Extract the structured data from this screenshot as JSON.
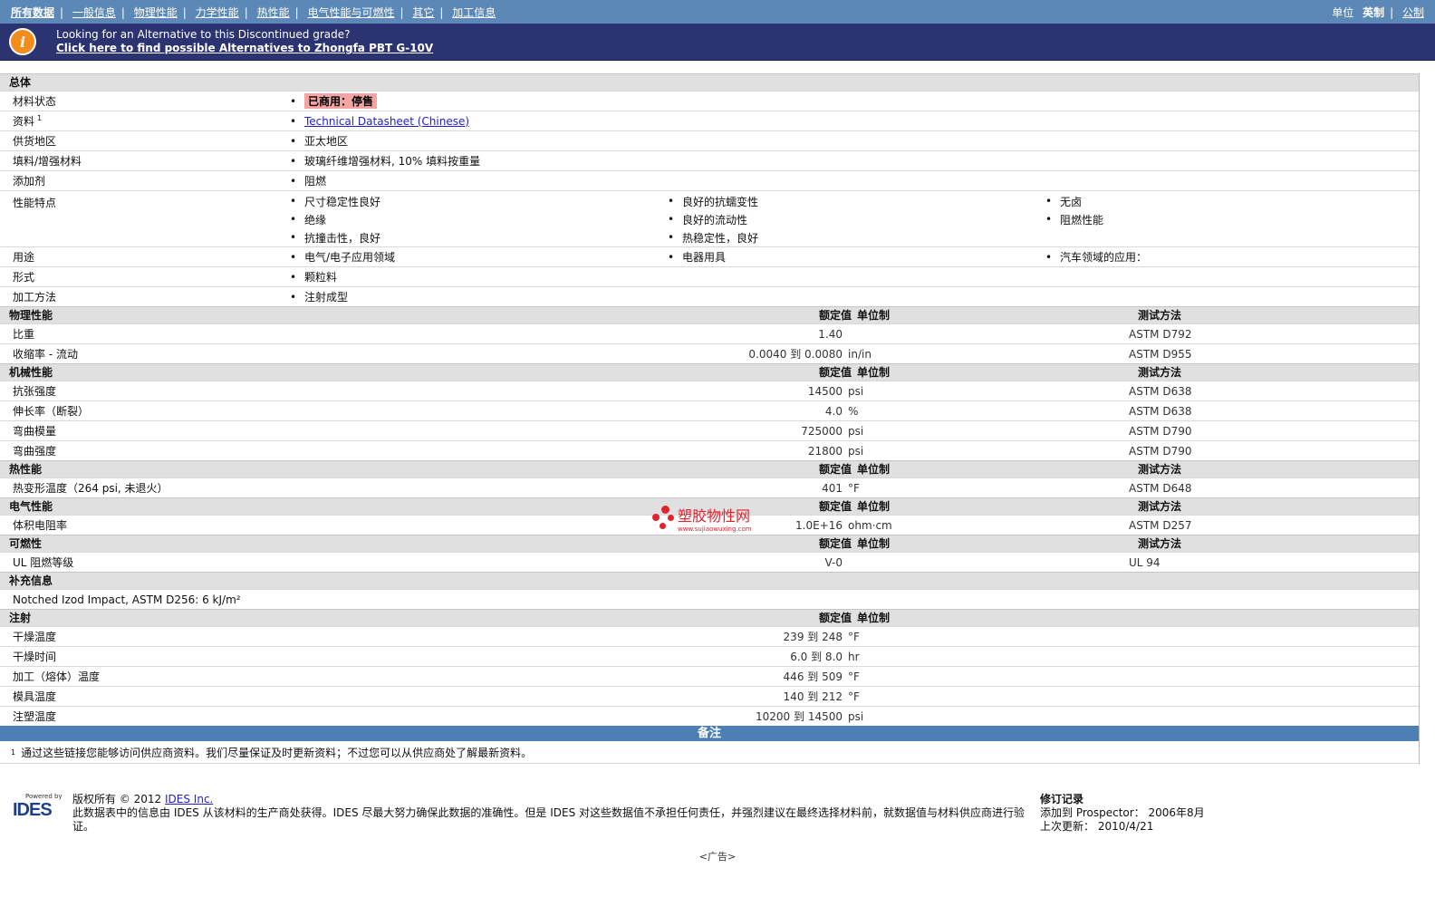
{
  "nav": {
    "items": [
      "所有数据",
      "一般信息",
      "物理性能",
      "力学性能",
      "热性能",
      "电气性能与可燃性",
      "其它",
      "加工信息"
    ],
    "units_label": "单位",
    "unit_english": "英制",
    "unit_metric": "公制"
  },
  "banner": {
    "line1": "Looking for an Alternative to this Discontinued grade?",
    "line2": "Click here to find possible Alternatives to Zhongfa PBT G-10V"
  },
  "general": {
    "title": "总体",
    "rows": [
      {
        "label": "材料状态",
        "values": [
          "已商用：停售"
        ]
      },
      {
        "label": "资料",
        "sup": "1",
        "values": [
          "Technical Datasheet (Chinese)"
        ]
      },
      {
        "label": "供货地区",
        "values": [
          "亚太地区"
        ]
      },
      {
        "label": "填料/增强材料",
        "values": [
          "玻璃纤维增强材料, 10% 填料按重量"
        ]
      },
      {
        "label": "添加剂",
        "values": [
          "阻燃"
        ]
      }
    ],
    "features_label": "性能特点",
    "features": [
      [
        "尺寸稳定性良好",
        "良好的抗蠕变性",
        "无卤"
      ],
      [
        "绝缘",
        "良好的流动性",
        "阻燃性能"
      ],
      [
        "抗撞击性，良好",
        "热稳定性，良好",
        ""
      ]
    ],
    "uses_label": "用途",
    "uses": [
      "电气/电子应用领域",
      "电器用具",
      "汽车领域的应用："
    ],
    "form_label": "形式",
    "form": "颗粒料",
    "process_label": "加工方法",
    "process": "注射成型"
  },
  "headers": {
    "value": "额定值",
    "unit": "单位制",
    "test": "测试方法"
  },
  "physical": {
    "title": "物理性能",
    "rows": [
      {
        "label": "比重",
        "value": "1.40",
        "unit": "",
        "test": "ASTM D792"
      },
      {
        "label": "收缩率 - 流动",
        "value": "0.0040 到 0.0080",
        "unit": "in/in",
        "test": "ASTM D955"
      }
    ]
  },
  "mechanical": {
    "title": "机械性能",
    "rows": [
      {
        "label": "抗张强度",
        "value": "14500",
        "unit": "psi",
        "test": "ASTM D638"
      },
      {
        "label": "伸长率（断裂）",
        "value": "4.0",
        "unit": "%",
        "test": "ASTM D638"
      },
      {
        "label": "弯曲模量",
        "value": "725000",
        "unit": "psi",
        "test": "ASTM D790"
      },
      {
        "label": "弯曲强度",
        "value": "21800",
        "unit": "psi",
        "test": "ASTM D790"
      }
    ]
  },
  "thermal": {
    "title": "热性能",
    "rows": [
      {
        "label": "热变形温度（264 psi, 未退火）",
        "value": "401",
        "unit": "°F",
        "test": "ASTM D648"
      }
    ]
  },
  "electrical": {
    "title": "电气性能",
    "rows": [
      {
        "label": "体积电阻率",
        "value": "1.0E+16",
        "unit": "ohm·cm",
        "test": "ASTM D257"
      }
    ]
  },
  "flammability": {
    "title": "可燃性",
    "rows": [
      {
        "label": "UL 阻燃等级",
        "value": "V-0",
        "unit": "",
        "test": "UL 94"
      }
    ]
  },
  "supplement": {
    "title": "补充信息",
    "text": "Notched Izod Impact, ASTM D256: 6 kJ/m²"
  },
  "injection": {
    "title": "注射",
    "rows": [
      {
        "label": "干燥温度",
        "value": "239 到 248",
        "unit": "°F"
      },
      {
        "label": "干燥时间",
        "value": "6.0 到 8.0",
        "unit": "hr"
      },
      {
        "label": "加工（熔体）温度",
        "value": "446 到 509",
        "unit": "°F"
      },
      {
        "label": "模具温度",
        "value": "140 到 212",
        "unit": "°F"
      },
      {
        "label": "注塑温度",
        "value": "10200 到 14500",
        "unit": "psi"
      }
    ]
  },
  "notes": {
    "title": "备注",
    "sup": "1",
    "text": "通过这些链接您能够访问供应商资料。我们尽量保证及时更新资料；不过您可以从供应商处了解最新资料。"
  },
  "footer": {
    "powered": "Powered by",
    "logo": "IDES",
    "copyright": "版权所有 © 2012",
    "company": "IDES Inc.",
    "disclaimer": "此数据表中的信息由 IDES 从该材料的生产商处获得。IDES 尽最大努力确保此数据的准确性。但是 IDES 对这些数据值不承担任何责任，并强烈建议在最终选择材料前，就数据值与材料供应商进行验证。",
    "rev_title": "修订记录",
    "added": "添加到 Prospector： 2006年8月",
    "updated": "上次更新： 2010/4/21",
    "ad": "<广告>"
  },
  "watermark": {
    "text": "塑胶物性网",
    "url": "www.sujiaowuxing.com"
  }
}
